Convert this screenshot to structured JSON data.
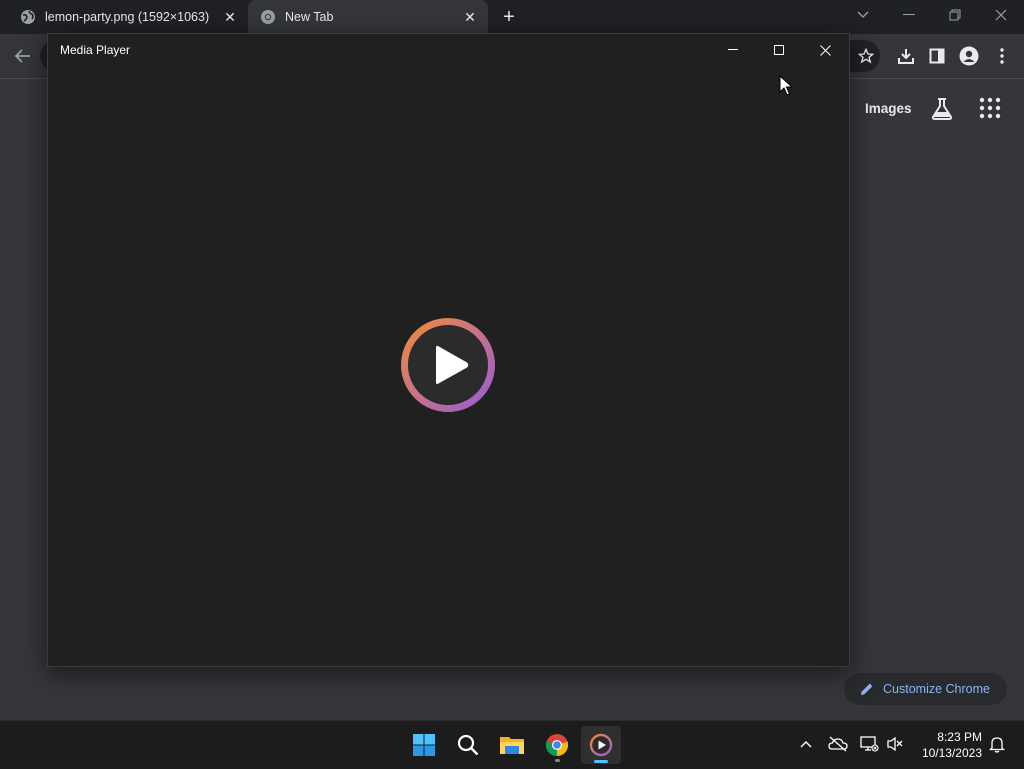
{
  "browser": {
    "tabs": [
      {
        "title": "lemon-party.png (1592×1063)",
        "favicon": "globe-icon",
        "close": "✕"
      },
      {
        "title": "New Tab",
        "favicon": "chrome-icon",
        "close": "✕",
        "active": true
      }
    ],
    "new_tab": "+",
    "ntp": {
      "images_link": "Images",
      "customize_label": "Customize Chrome"
    }
  },
  "media_player": {
    "title": "Media Player",
    "play_icon": "play-icon"
  },
  "taskbar": {
    "apps": [
      "windows-start-icon",
      "search-icon",
      "file-explorer-icon",
      "chrome-icon",
      "media-player-icon"
    ],
    "clock": {
      "time": "8:23 PM",
      "date": "10/13/2023"
    }
  },
  "colors": {
    "accent": "#8ab4f8",
    "taskbar_indicator": "#4cc2ff",
    "play_ring_start": "#f08a3c",
    "play_ring_end": "#9a5cd6"
  }
}
